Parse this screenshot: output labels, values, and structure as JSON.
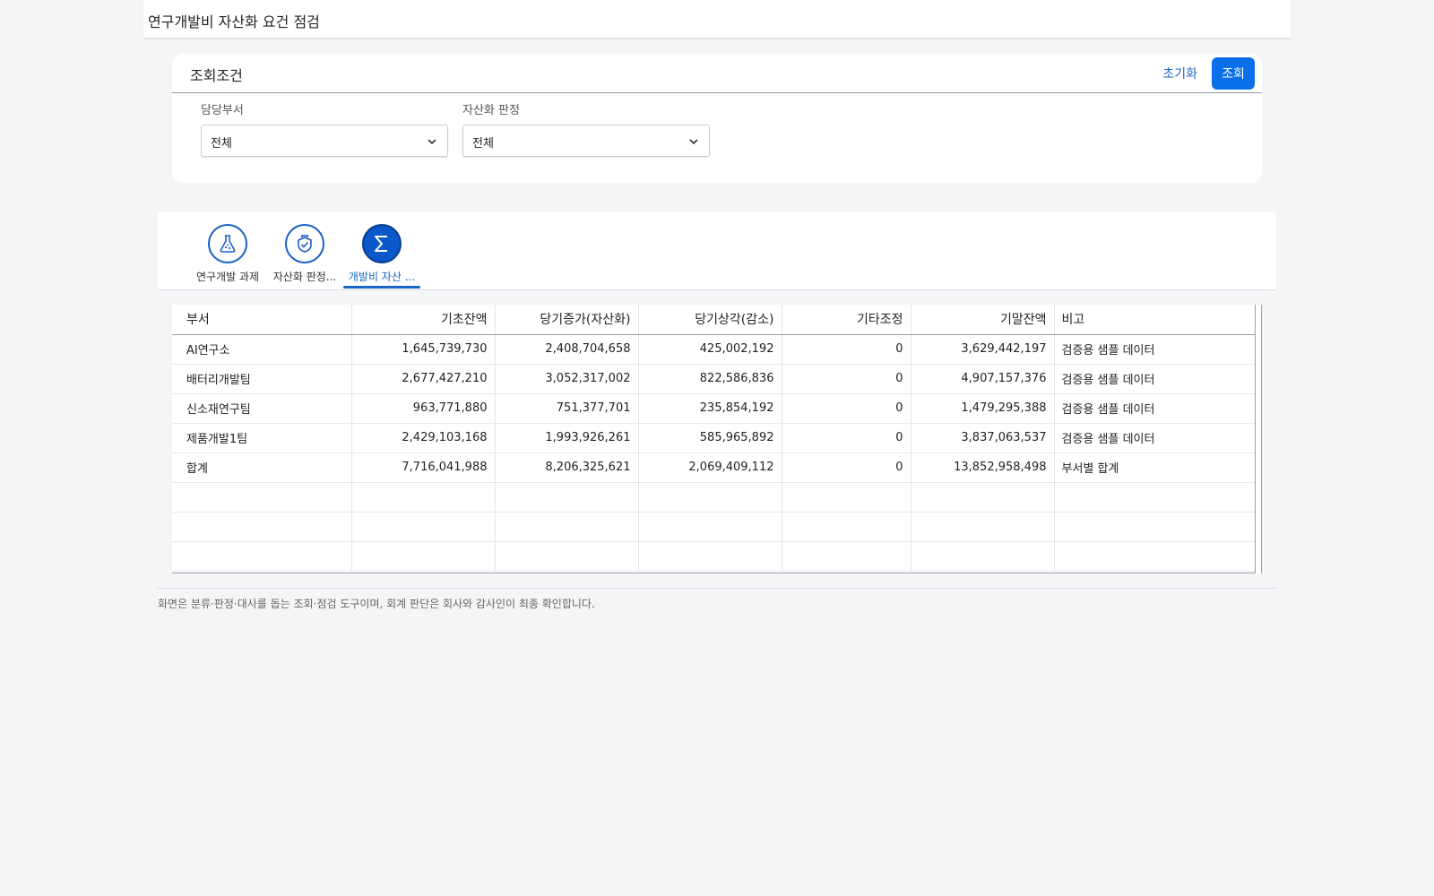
{
  "title_bar": {
    "title": "연구개발비 자산화 요건 점검"
  },
  "search": {
    "label": "조회조건",
    "reset_label": "초기화",
    "search_label": "조회",
    "fields": [
      {
        "label": "담당부서",
        "value": "전체"
      },
      {
        "label": "자산화 판정",
        "value": "전체"
      }
    ]
  },
  "tabs": [
    {
      "label": "연구개발 과제",
      "icon": "flask-icon",
      "active": false
    },
    {
      "label": "자산화 판정...",
      "icon": "shield-check-icon",
      "active": false
    },
    {
      "label": "개발비 자산 ...",
      "icon": "sigma-icon",
      "active": true
    }
  ],
  "table": {
    "columns": [
      "부서",
      "기초잔액",
      "당기증가(자산화)",
      "당기상각(감소)",
      "기타조정",
      "기말잔액",
      "비고"
    ],
    "rows": [
      [
        "AI연구소",
        "1,645,739,730",
        "2,408,704,658",
        "425,002,192",
        "0",
        "3,629,442,197",
        "검증용 샘플 데이터"
      ],
      [
        "배터리개발팀",
        "2,677,427,210",
        "3,052,317,002",
        "822,586,836",
        "0",
        "4,907,157,376",
        "검증용 샘플 데이터"
      ],
      [
        "신소재연구팀",
        "963,771,880",
        "751,377,701",
        "235,854,192",
        "0",
        "1,479,295,388",
        "검증용 샘플 데이터"
      ],
      [
        "제품개발1팀",
        "2,429,103,168",
        "1,993,926,261",
        "585,965,892",
        "0",
        "3,837,063,537",
        "검증용 샘플 데이터"
      ],
      [
        "합계",
        "7,716,041,988",
        "8,206,325,621",
        "2,069,409,112",
        "0",
        "13,852,958,498",
        "부서별 합계"
      ]
    ]
  },
  "footnote": "화면은 분류·판정·대사를 돕는 조회·점검 도구이며, 회계 판단은 회사와 감사인이 최종 확인합니다.",
  "colors": {
    "accent": "#0a6fe8",
    "link": "#1a66c9",
    "tab_active": "#0a58c9"
  }
}
